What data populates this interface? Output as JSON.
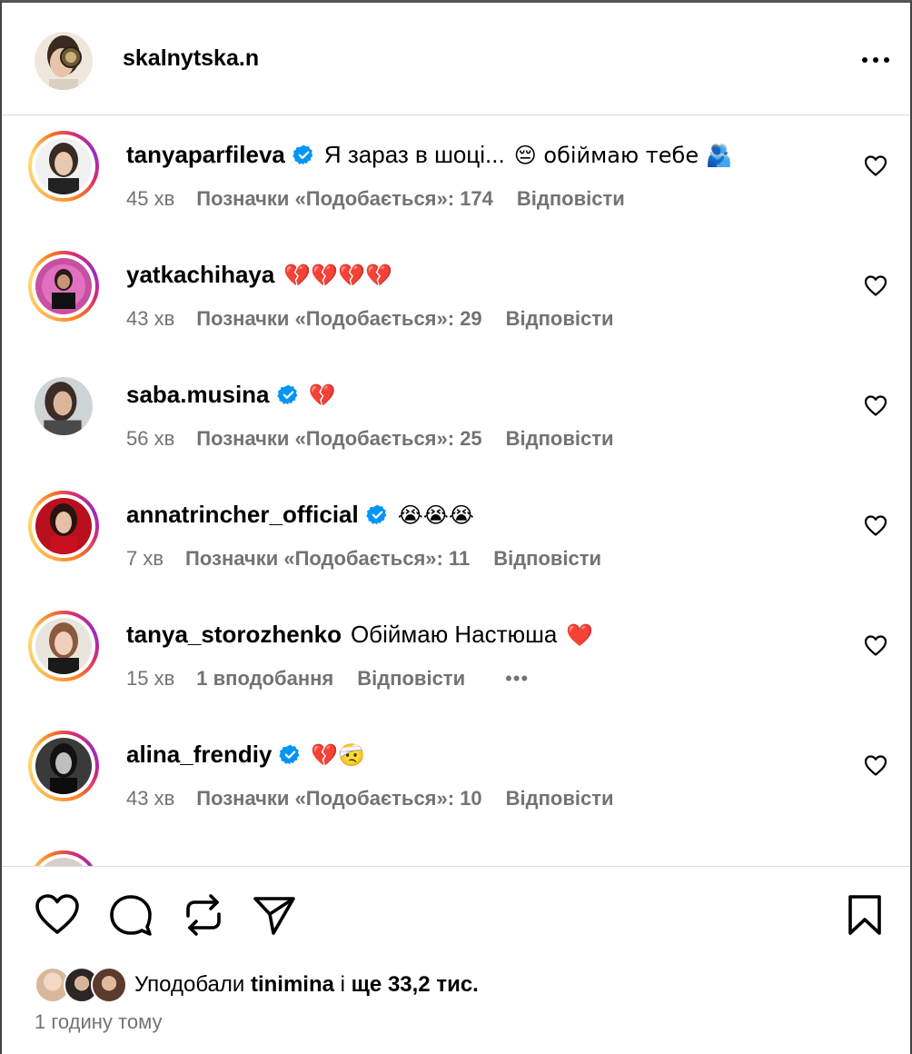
{
  "header": {
    "username": "skalnytska.n",
    "more_icon": "more-horizontal-icon"
  },
  "comments": [
    {
      "username": "tanyaparfileva",
      "verified": true,
      "story_ring": true,
      "text": "Я зараз в шоці...",
      "emoji": "😔 обіймаю тебе 🫂",
      "time": "45 хв",
      "likes": "Позначки «Подобається»: 174",
      "reply": "Відповісти"
    },
    {
      "username": "yatkachihaya",
      "verified": false,
      "story_ring": true,
      "text": "",
      "emoji": "💔💔💔💔",
      "time": "43 хв",
      "likes": "Позначки «Подобається»: 29",
      "reply": "Відповісти"
    },
    {
      "username": "saba.musina",
      "verified": true,
      "story_ring": false,
      "text": "",
      "emoji": "💔",
      "time": "56 хв",
      "likes": "Позначки «Подобається»: 25",
      "reply": "Відповісти"
    },
    {
      "username": "annatrincher_official",
      "verified": true,
      "story_ring": true,
      "text": "",
      "emoji": "😭😭😭",
      "time": "7 хв",
      "likes": "Позначки «Подобається»: 11",
      "reply": "Відповісти"
    },
    {
      "username": "tanya_storozhenko",
      "verified": false,
      "story_ring": true,
      "text": "Обіймаю Настюша",
      "emoji": "❤️",
      "time": "15 хв",
      "likes": "1 вподобання",
      "reply": "Відповісти",
      "more": "•••"
    },
    {
      "username": "alina_frendiy",
      "verified": true,
      "story_ring": true,
      "text": "",
      "emoji": "💔🤕",
      "time": "43 хв",
      "likes": "Позначки «Подобається»: 10",
      "reply": "Відповісти"
    }
  ],
  "actions": {
    "like_icon": "heart-icon",
    "comment_icon": "comment-icon",
    "repost_icon": "repost-icon",
    "share_icon": "send-icon",
    "save_icon": "bookmark-icon"
  },
  "likes_summary": {
    "prefix": "Уподобали",
    "user": "tinimina",
    "middle": "і",
    "rest": "ще 33,2 тис."
  },
  "timestamp": "1 годину тому",
  "colors": {
    "verified": "#0095f6",
    "secondary_text": "#737373",
    "divider": "#dbdbdb"
  }
}
